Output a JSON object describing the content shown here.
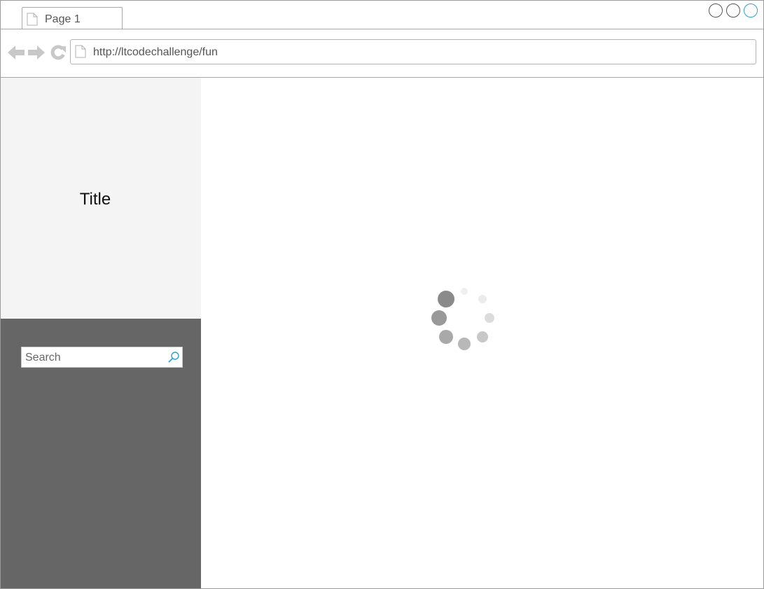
{
  "tab": {
    "label": "Page 1"
  },
  "address_bar": {
    "url": "http://ltcodechallenge/fun"
  },
  "sidebar": {
    "title": "Title"
  },
  "search": {
    "placeholder": "Search"
  },
  "icons": {
    "tab": "page-icon",
    "address": "page-icon",
    "back": "arrow-left-icon",
    "forward": "arrow-right-icon",
    "reload": "reload-icon",
    "search": "magnifier-icon",
    "loading": "loading-spinner-icon"
  },
  "colors": {
    "sidebar_top": "#f4f4f4",
    "sidebar_bottom": "#666666",
    "accent": "#2a9fd6",
    "nav_icons": "#c8c8c8"
  }
}
